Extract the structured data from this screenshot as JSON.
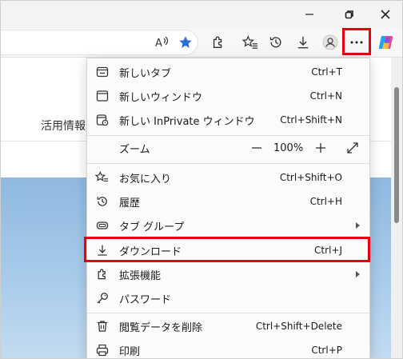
{
  "window": {
    "minimize_icon": "minimize-icon",
    "restore_icon": "restore-icon",
    "close_icon": "close-icon"
  },
  "toolbar": {
    "icons": [
      "read-aloud-icon",
      "favorite-star-icon",
      "extensions-icon",
      "favorites-icon",
      "history-icon",
      "downloads-icon",
      "profile-icon",
      "more-icon",
      "copilot-icon"
    ],
    "star_color": "#2b6fd6",
    "highlight_color": "#e60012"
  },
  "page": {
    "text": "活用情報"
  },
  "menu": {
    "items": [
      {
        "label": "新しいタブ",
        "shortcut": "Ctrl+T",
        "icon": "new-tab-icon"
      },
      {
        "label": "新しいウィンドウ",
        "shortcut": "Ctrl+N",
        "icon": "new-window-icon"
      },
      {
        "label": "新しい InPrivate ウィンドウ",
        "shortcut": "Ctrl+Shift+N",
        "icon": "inprivate-icon"
      },
      {
        "label": "お気に入り",
        "shortcut": "Ctrl+Shift+O",
        "icon": "favorites-icon"
      },
      {
        "label": "履歴",
        "shortcut": "Ctrl+H",
        "icon": "history-icon"
      },
      {
        "label": "タブ グループ",
        "shortcut": "",
        "icon": "tab-groups-icon"
      },
      {
        "label": "ダウンロード",
        "shortcut": "Ctrl+J",
        "icon": "download-icon"
      },
      {
        "label": "拡張機能",
        "shortcut": "",
        "icon": "extensions-icon"
      },
      {
        "label": "パスワード",
        "shortcut": "",
        "icon": "key-icon"
      },
      {
        "label": "閲覧データを削除",
        "shortcut": "Ctrl+Shift+Delete",
        "icon": "trash-icon"
      },
      {
        "label": "印刷",
        "shortcut": "Ctrl+P",
        "icon": "print-icon"
      }
    ],
    "zoom": {
      "label": "ズーム",
      "value": "100%",
      "minus": "—",
      "plus": "+"
    }
  }
}
